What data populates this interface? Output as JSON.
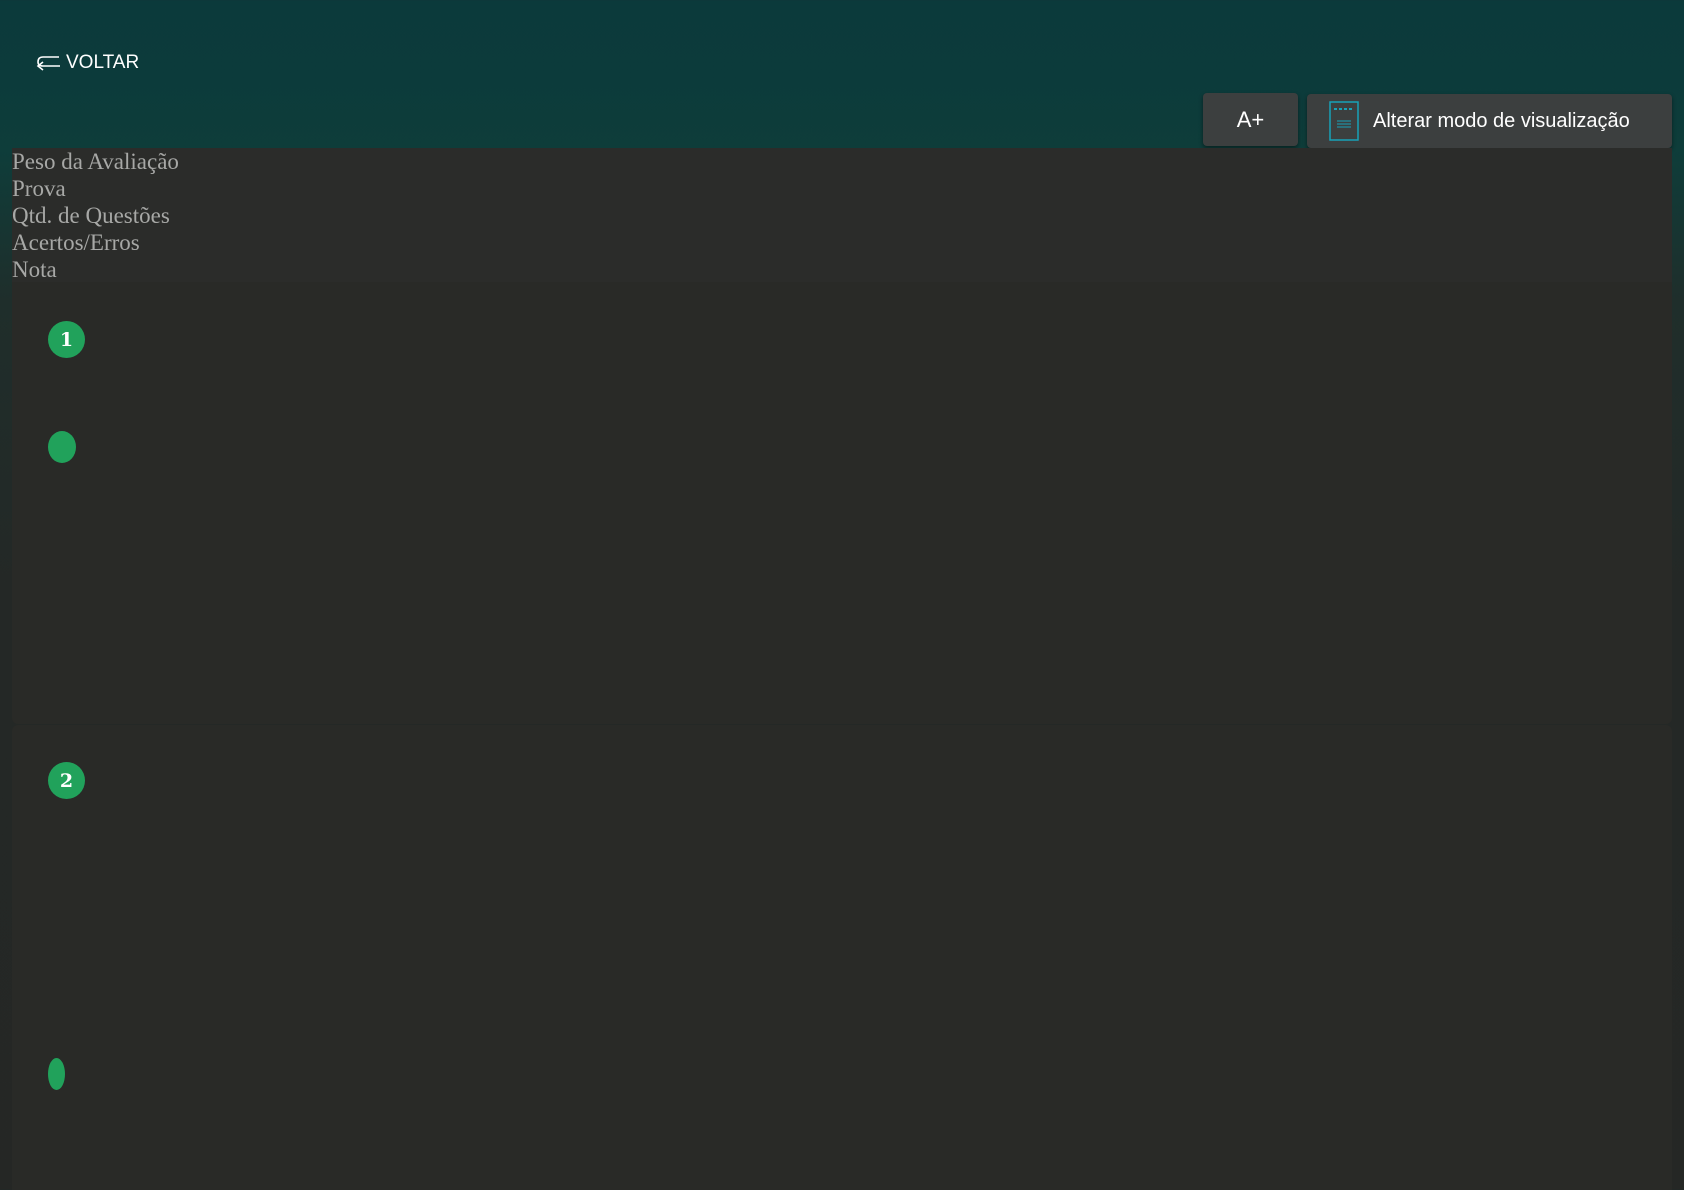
{
  "nav": {
    "back_label": "VOLTAR",
    "back_icon": "return-arrow-icon"
  },
  "toolbar": {
    "font_size_label": "A+",
    "view_mode_label": "Alterar modo de visualização",
    "view_mode_icon": "document-icon"
  },
  "table_header": {
    "columns": [
      "Peso da Avaliação",
      "Prova",
      "Qtd. de Questões",
      "Acertos/Erros",
      "Nota"
    ]
  },
  "questions": [
    {
      "number": "1"
    },
    {
      "number": "2"
    }
  ],
  "colors": {
    "accent_green": "#21a25b",
    "header_bg": "#0c3b3b",
    "card_bg": "#292a27",
    "button_bg": "#3c3f3f",
    "icon_teal": "#17a2b8"
  }
}
